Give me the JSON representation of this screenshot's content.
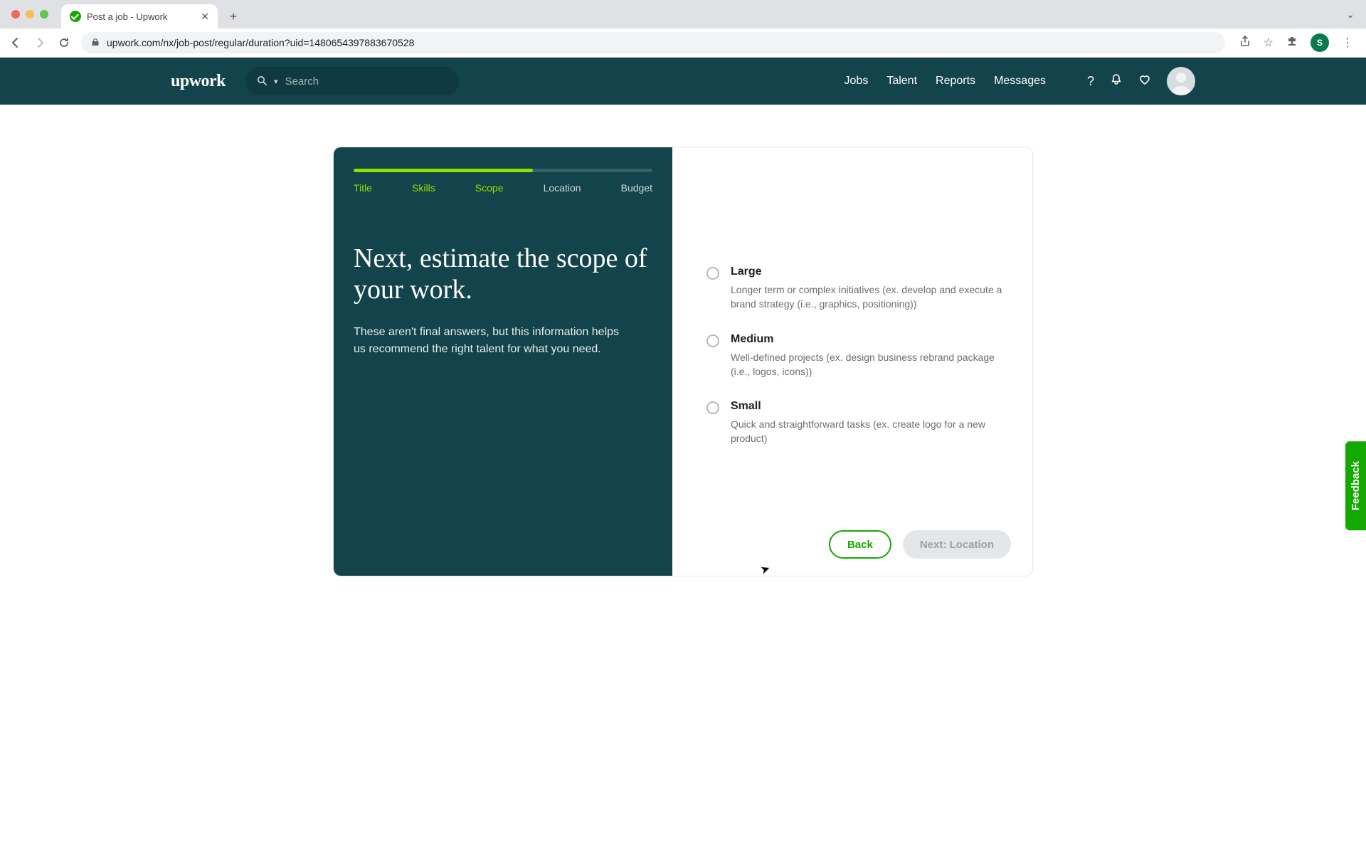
{
  "browser": {
    "tab_title": "Post a job - Upwork",
    "url": "upwork.com/nx/job-post/regular/duration?uid=1480654397883670528"
  },
  "header": {
    "logo": "upwork",
    "search_placeholder": "Search",
    "nav": [
      "Jobs",
      "Talent",
      "Reports",
      "Messages"
    ],
    "avatar_initial": "S"
  },
  "progress": {
    "percent": 60,
    "steps": [
      {
        "label": "Title",
        "done": true
      },
      {
        "label": "Skills",
        "done": true
      },
      {
        "label": "Scope",
        "done": true
      },
      {
        "label": "Location",
        "done": false
      },
      {
        "label": "Budget",
        "done": false
      }
    ]
  },
  "left": {
    "headline": "Next, estimate the scope of your work.",
    "subtext": "These aren't final answers, but this information helps us recommend the right talent for what you need."
  },
  "options": [
    {
      "label": "Large",
      "desc": "Longer term or complex initiatives (ex. develop and execute a brand strategy (i.e., graphics, positioning))"
    },
    {
      "label": "Medium",
      "desc": "Well-defined projects (ex. design business rebrand package (i.e., logos, icons))"
    },
    {
      "label": "Small",
      "desc": "Quick and straightforward tasks (ex. create logo for a new product)"
    }
  ],
  "buttons": {
    "back": "Back",
    "next": "Next: Location"
  },
  "feedback": "Feedback"
}
